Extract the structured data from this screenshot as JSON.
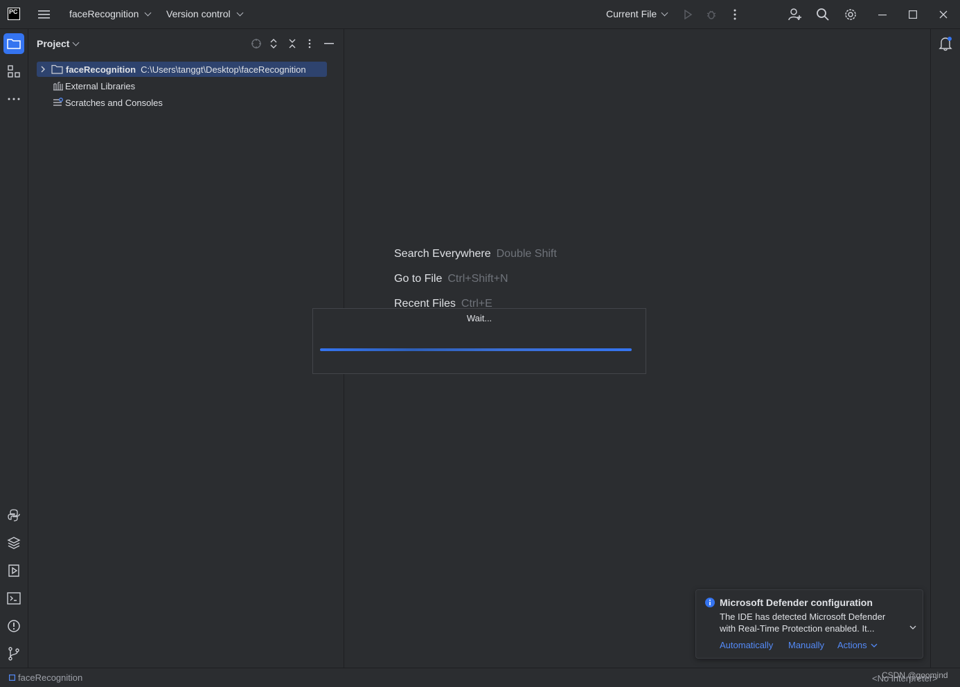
{
  "titlebar": {
    "logo": "PC",
    "project_name": "faceRecognition",
    "version_control": "Version control",
    "run_config": "Current File"
  },
  "project_panel": {
    "title": "Project",
    "tree": [
      {
        "label": "faceRecognition",
        "path": "C:\\Users\\tanggt\\Desktop\\faceRecognition",
        "selected": true
      },
      {
        "label": "External Libraries"
      },
      {
        "label": "Scratches and Consoles"
      }
    ]
  },
  "editor_hints": [
    {
      "label": "Search Everywhere",
      "shortcut": "Double Shift"
    },
    {
      "label": "Go to File",
      "shortcut": "Ctrl+Shift+N"
    },
    {
      "label": "Recent Files",
      "shortcut": "Ctrl+E"
    }
  ],
  "wait_dialog": {
    "text": "Wait..."
  },
  "notification": {
    "title": "Microsoft Defender configuration",
    "body_line1": "The IDE has detected Microsoft Defender",
    "body_line2": "with Real-Time Protection enabled. It...",
    "actions": [
      "Automatically",
      "Manually",
      "Actions"
    ]
  },
  "statusbar": {
    "project": "faceRecognition",
    "interpreter": "<No interpreter>",
    "watermark": "CSDN @goomind"
  },
  "colors": {
    "background": "#2b2d30",
    "accent": "#3574f0",
    "selection": "#2e436e",
    "link": "#548af7"
  }
}
